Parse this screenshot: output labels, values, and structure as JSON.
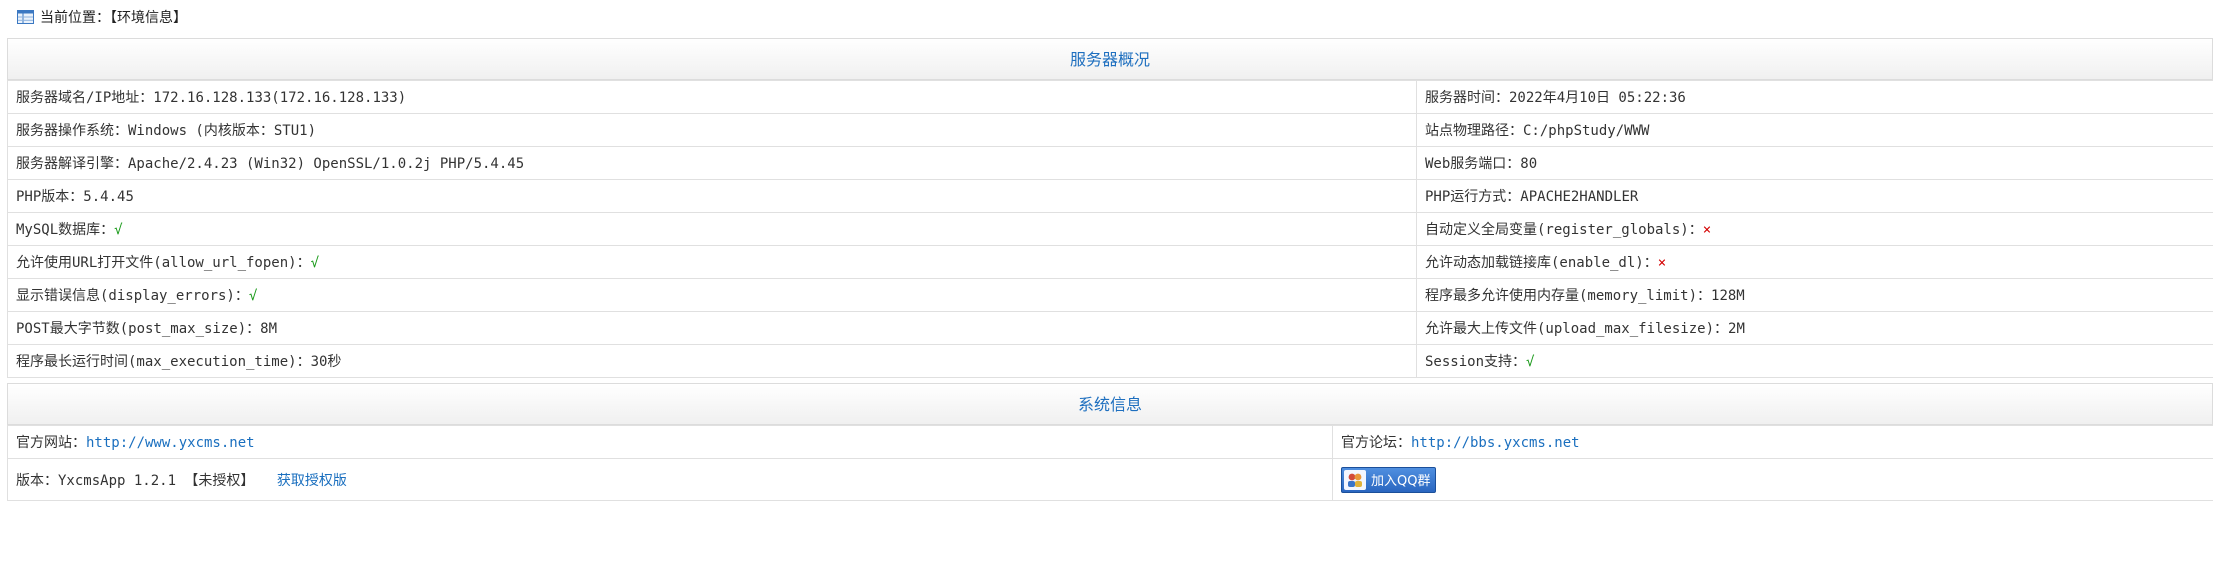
{
  "breadcrumb": {
    "label": "当前位置：【环境信息】"
  },
  "server": {
    "title": "服务器概况",
    "rows": [
      [
        {
          "label": "服务器域名/IP地址：",
          "value": "172.16.128.133(172.16.128.133)",
          "status": ""
        },
        {
          "label": "服务器时间：",
          "value": "2022年4月10日 05:22:36",
          "status": ""
        }
      ],
      [
        {
          "label": "服务器操作系统：",
          "value": "Windows (内核版本：STU1)",
          "status": ""
        },
        {
          "label": "站点物理路径：",
          "value": "C:/phpStudy/WWW",
          "status": ""
        }
      ],
      [
        {
          "label": "服务器解译引擎：",
          "value": "Apache/2.4.23 (Win32) OpenSSL/1.0.2j PHP/5.4.45",
          "status": ""
        },
        {
          "label": "Web服务端口：",
          "value": "80",
          "status": ""
        }
      ],
      [
        {
          "label": "PHP版本：",
          "value": "5.4.45",
          "status": ""
        },
        {
          "label": "PHP运行方式：",
          "value": "APACHE2HANDLER",
          "status": ""
        }
      ],
      [
        {
          "label": "MySQL数据库：",
          "value": "",
          "status": "√"
        },
        {
          "label": "自动定义全局变量(register_globals)：",
          "value": "",
          "status": "×"
        }
      ],
      [
        {
          "label": "允许使用URL打开文件(allow_url_fopen)：",
          "value": "",
          "status": "√"
        },
        {
          "label": "允许动态加载链接库(enable_dl)：",
          "value": "",
          "status": "×"
        }
      ],
      [
        {
          "label": "显示错误信息(display_errors)：",
          "value": "",
          "status": "√"
        },
        {
          "label": "程序最多允许使用内存量(memory_limit)：",
          "value": "128M",
          "status": ""
        }
      ],
      [
        {
          "label": "POST最大字节数(post_max_size)：",
          "value": "8M",
          "status": ""
        },
        {
          "label": "允许最大上传文件(upload_max_filesize)：",
          "value": "2M",
          "status": ""
        }
      ],
      [
        {
          "label": "程序最长运行时间(max_execution_time)：",
          "value": "30秒",
          "status": ""
        },
        {
          "label": "Session支持：",
          "value": "",
          "status": "√"
        }
      ]
    ]
  },
  "system": {
    "title": "系统信息",
    "official_site_label": "官方网站：",
    "official_site_url": "http://www.yxcms.net",
    "forum_label": "官方论坛：",
    "forum_url": "http://bbs.yxcms.net",
    "version_label": "版本：",
    "version_value": "YxcmsApp 1.2.1 【未授权】",
    "get_license": "获取授权版",
    "qq_button": "加入QQ群"
  },
  "colors": {
    "accent": "#1e6fbf",
    "ok": "#1a9a1a",
    "no": "#d40000"
  },
  "icons": [
    "table-icon",
    "qq-group-icon"
  ]
}
